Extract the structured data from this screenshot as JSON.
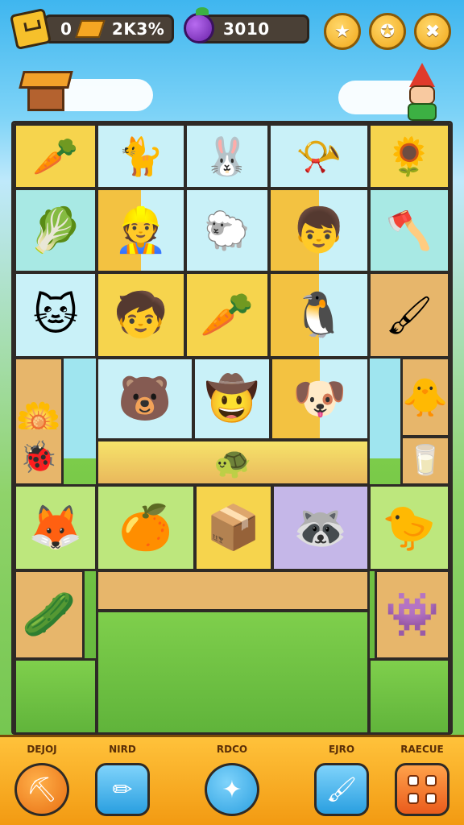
{
  "hud": {
    "gold_prefix": "0",
    "gold_value": "2K3%",
    "gem_value": "3010",
    "badge_icon": "level-badge-icon",
    "gold_icon": "gold-bar-icon",
    "gem_icon": "grape-gem-icon",
    "buttons": [
      {
        "icon": "star-icon",
        "glyph": "★"
      },
      {
        "icon": "achievement-icon",
        "glyph": "✪"
      },
      {
        "icon": "tools-icon",
        "glyph": "✖"
      }
    ]
  },
  "board": {
    "tiles": [
      {
        "glyph": "🥕",
        "icon": "carrot-sprout-icon"
      },
      {
        "glyph": "🐈",
        "icon": "red-cat-icon"
      },
      {
        "glyph": "🐰",
        "icon": "white-bunny-icon"
      },
      {
        "glyph": "📯",
        "icon": "horn-cannon-icon"
      },
      {
        "glyph": "🌻",
        "icon": "sunflower-icon"
      },
      {
        "glyph": "🥬",
        "icon": "leaf-crop-icon"
      },
      {
        "glyph": "👷",
        "icon": "builder-character-icon"
      },
      {
        "glyph": "🐑",
        "icon": "sheep-icon"
      },
      {
        "glyph": "👦",
        "icon": "blue-cap-kid-icon"
      },
      {
        "glyph": "🪓",
        "icon": "brush-tool-icon"
      },
      {
        "glyph": "🐱",
        "icon": "yellow-cat-icon"
      },
      {
        "glyph": "🧒",
        "icon": "red-hair-kid-icon"
      },
      {
        "glyph": "🥕",
        "icon": "flower-carrot-icon"
      },
      {
        "glyph": "🐧",
        "icon": "blue-bird-icon"
      },
      {
        "glyph": "🖌",
        "icon": "paint-roller-icon"
      },
      {
        "glyph": "🌼",
        "icon": "yellow-flower-icon"
      },
      {
        "glyph": "🐻",
        "icon": "wood-bear-icon"
      },
      {
        "glyph": "🤠",
        "icon": "farmer-hat-icon"
      },
      {
        "glyph": "🐶",
        "icon": "yellow-dog-icon"
      },
      {
        "glyph": "🐥",
        "icon": "yellow-chick-icon"
      },
      {
        "glyph": "🐞",
        "icon": "red-bug-icon"
      },
      {
        "glyph": "🐢",
        "icon": "turtle-icon"
      },
      {
        "glyph": "🥛",
        "icon": "milk-jar-icon"
      },
      {
        "glyph": "🦊",
        "icon": "fox-icon"
      },
      {
        "glyph": "🍊",
        "icon": "orange-kid-icon"
      },
      {
        "glyph": "📦",
        "icon": "crate-stack-icon"
      },
      {
        "glyph": "🦝",
        "icon": "red-raccoon-icon"
      },
      {
        "glyph": "🐤",
        "icon": "beak-bird-icon"
      },
      {
        "glyph": "🥒",
        "icon": "cucumber-icon"
      },
      {
        "glyph": "👾",
        "icon": "purple-monster-icon"
      }
    ]
  },
  "nav": [
    {
      "label": "DEJOJ",
      "icon": "shovel-icon",
      "glyph": "⛏"
    },
    {
      "label": "NIRD",
      "icon": "pencil-icon",
      "glyph": "✏"
    },
    {
      "label": "RDCO",
      "icon": "magic-wand-icon",
      "glyph": "✦"
    },
    {
      "label": "EJRO",
      "icon": "brush-icon",
      "glyph": "🖌"
    },
    {
      "label": "RAECUE",
      "icon": "grid-menu-icon",
      "glyph": ""
    }
  ]
}
